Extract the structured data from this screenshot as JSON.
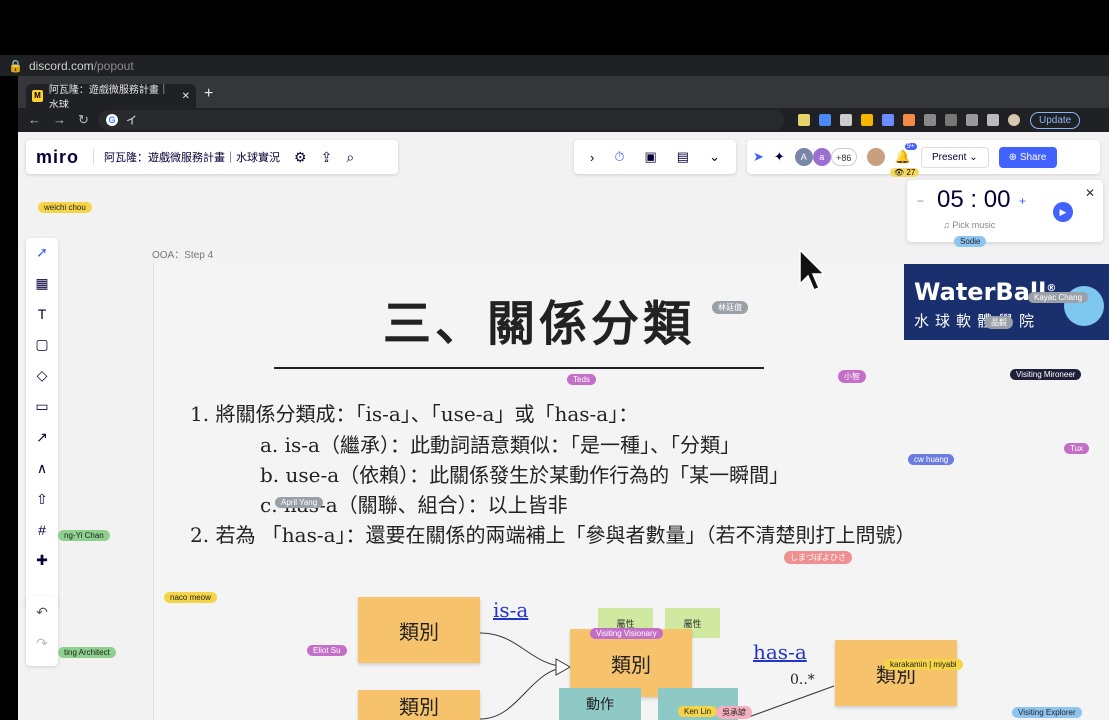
{
  "browser": {
    "url_host": "discord.com",
    "url_path": "/popout",
    "tab_title": "阿瓦隆：遊戲微服務計畫｜水球",
    "tab_favicon": "M",
    "omnibox_text": "イ",
    "update_label": "Update"
  },
  "toolbar": {
    "logo": "miro",
    "board_title": "阿瓦隆：遊戲微服務計畫｜水球實況",
    "present_label": "Present",
    "share_label": "Share",
    "collaborator_count": "+86",
    "viewer_count": "27",
    "notification_badge": "9+"
  },
  "timer": {
    "minutes": "05",
    "seconds": "00",
    "music_label": "Pick music"
  },
  "frame": {
    "label": "OOA：Step 4"
  },
  "slide": {
    "heading": "三、關係分類",
    "line1": "1. 將關係分類成：「is-a」、「use-a」或「has-a」：",
    "line_a": "a. is-a（繼承）：此動詞語意類似：「是一種」、「分類」",
    "line_b": "b. use-a（依賴）：此關係發生於某動作行為的「某一瞬間」",
    "line_c": "c. has-a（關聯、組合）：以上皆非",
    "line2": "2. 若為 「has-a」：還要在關係的兩端補上「參與者數量」（若不清楚則打上問號）"
  },
  "diagram": {
    "sticky1": "類別",
    "sticky2": "類別",
    "sticky3": "類別",
    "sticky4": "類別",
    "attr1": "屬性",
    "attr2": "屬性",
    "action": "動作",
    "isa_label": "is-a",
    "hasa_label": "has-a",
    "multiplicity": "0..*"
  },
  "waterball": {
    "title": "WaterBall",
    "subtitle": "水球軟體學院",
    "reg": "®"
  },
  "cursors": [
    {
      "name": "weichi chou",
      "color": "#f5d547"
    },
    {
      "name": "林廷億",
      "color": "#9aa0a8"
    },
    {
      "name": "Teds",
      "color": "#c46fc7"
    },
    {
      "name": "小智",
      "color": "#c46fc7"
    },
    {
      "name": "Kayac Chang",
      "color": "#9aa0a8"
    },
    {
      "name": "Visiting Mironeer",
      "color": "#1f1f3a"
    },
    {
      "name": "Tux",
      "color": "#c46fc7"
    },
    {
      "name": "cw huang",
      "color": "#6b7ce0"
    },
    {
      "name": "April Yang",
      "color": "#9aa0a8"
    },
    {
      "name": "ng-Yi Chan",
      "color": "#8ed08e"
    },
    {
      "name": "しまづぽよひさ",
      "color": "#f08f8f"
    },
    {
      "name": "naco meow",
      "color": "#f5d547"
    },
    {
      "name": "Visiting Visionary",
      "color": "#c46fc7"
    },
    {
      "name": "Eliot Su",
      "color": "#c46fc7"
    },
    {
      "name": "ting Architect",
      "color": "#8ed08e"
    },
    {
      "name": "karakamin | miyabi",
      "color": "#f5d547"
    },
    {
      "name": "Ken Lin",
      "color": "#f5d547"
    },
    {
      "name": "吳承諺",
      "color": "#f5b0c0"
    },
    {
      "name": "Visiting Explorer",
      "color": "#8ec5f0"
    },
    {
      "name": "Sodie",
      "color": "#8ec5f0"
    },
    {
      "name": "品毅",
      "color": "#9aa0a8"
    }
  ]
}
